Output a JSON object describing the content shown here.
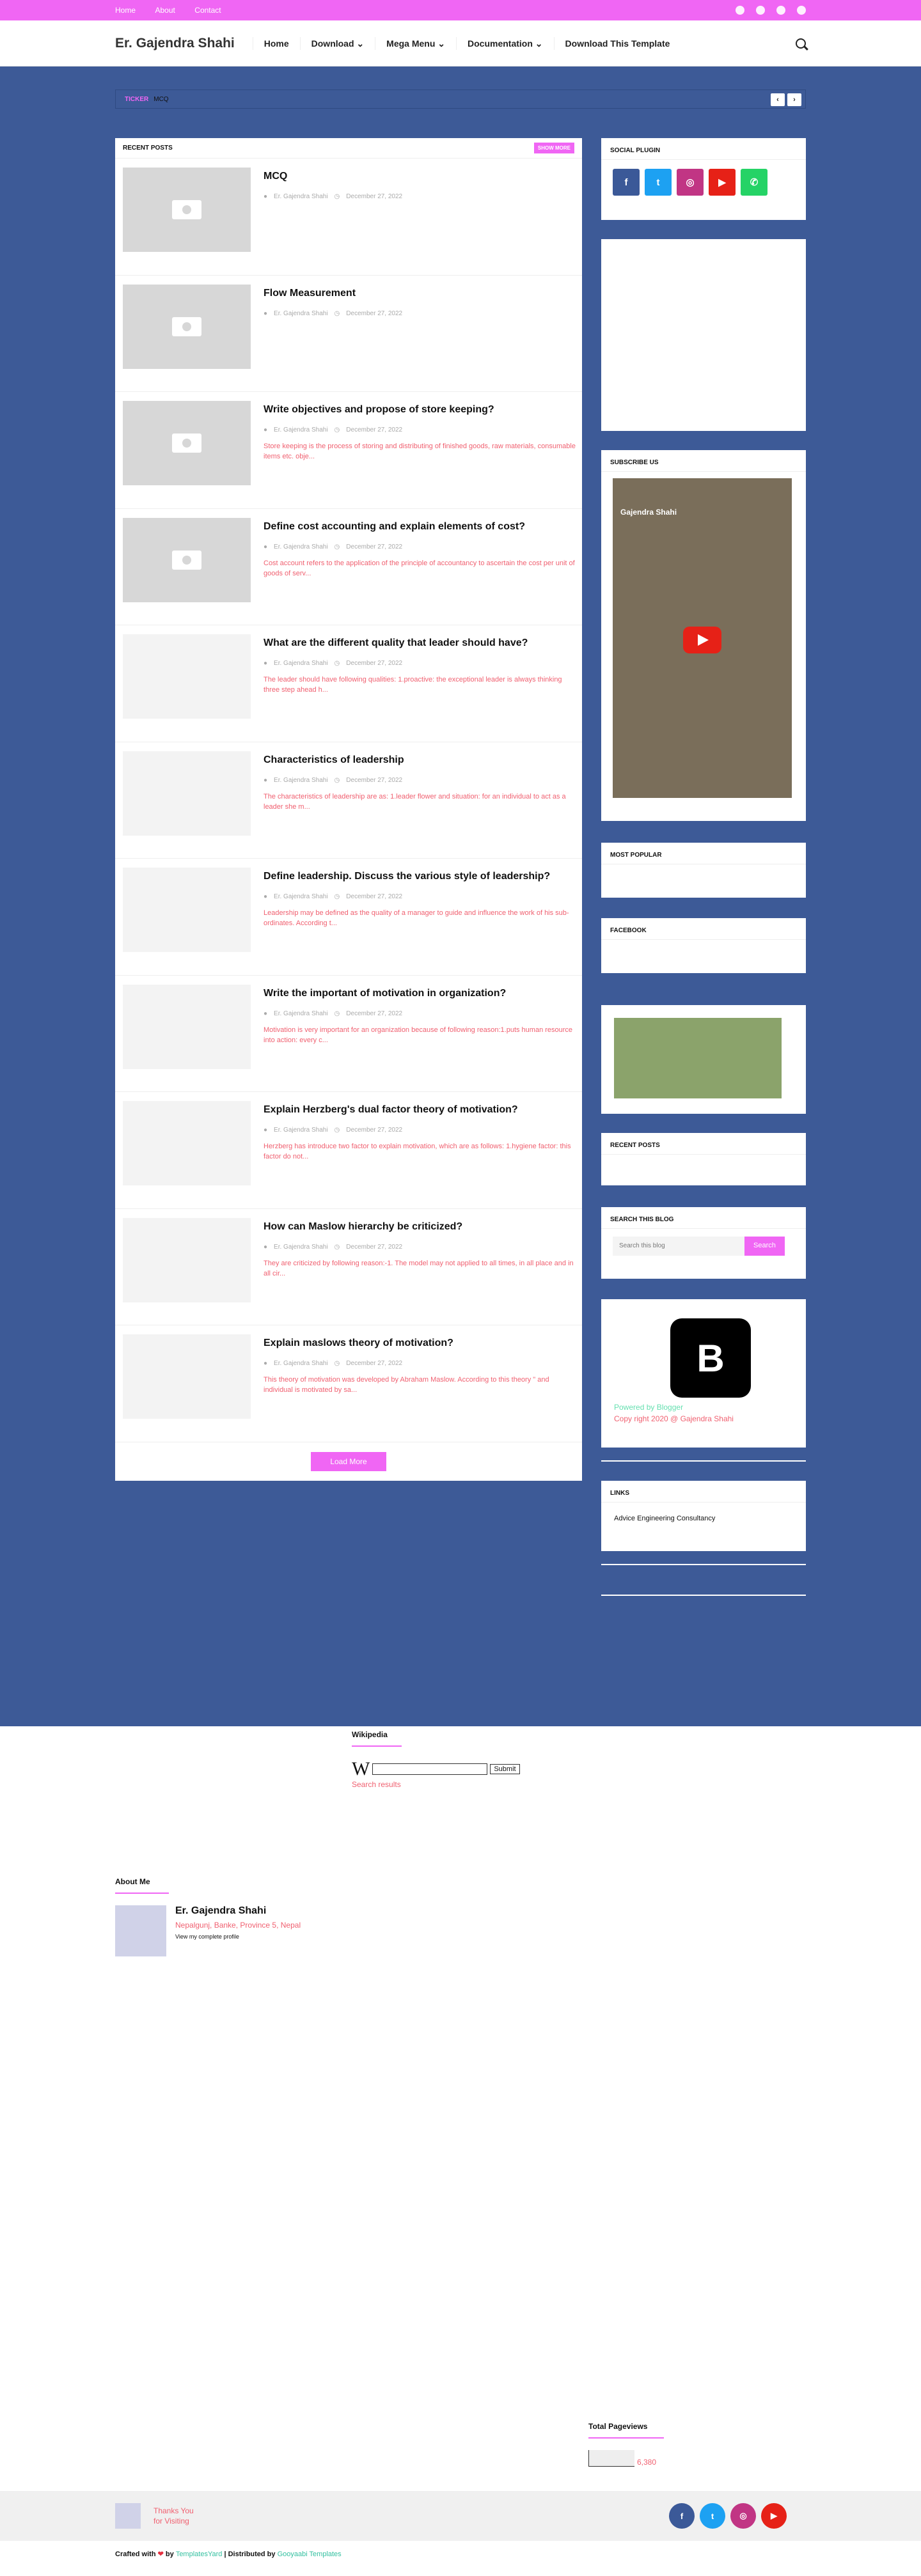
{
  "topbar": {
    "links": [
      "Home",
      "About",
      "Contact"
    ],
    "social_icons": [
      "facebook-icon",
      "twitter-icon",
      "instagram-icon",
      "pinterest-icon"
    ]
  },
  "header": {
    "brand": "Er. Gajendra Shahi",
    "nav": [
      "Home",
      "Download",
      "Mega Menu",
      "Documentation",
      "Download This Template"
    ]
  },
  "ticker": {
    "label": "TICKER",
    "text": "MCQ"
  },
  "main": {
    "title": "RECENT POSTS",
    "more": "SHOW MORE",
    "author": "Er. Gajendra Shahi",
    "date": "December 27, 2022",
    "posts": [
      {
        "title": "MCQ",
        "excerpt": ""
      },
      {
        "title": "Flow Measurement",
        "excerpt": ""
      },
      {
        "title": "Write objectives and propose of store keeping?",
        "excerpt": "Store keeping is the process of storing and distributing of finished goods, raw materials, consumable items etc. obje..."
      },
      {
        "title": "Define cost accounting and explain elements of cost?",
        "excerpt": "Cost account refers to the application of the principle of accountancy to ascertain the cost per unit of goods of serv..."
      },
      {
        "title": "What are the different quality that leader should have?",
        "excerpt": "The leader should have following qualities: 1.proactive: the exceptional leader is always thinking three step ahead h..."
      },
      {
        "title": "Characteristics of leadership",
        "excerpt": "The characteristics of leadership are as: 1.leader flower and situation: for an individual to act as a leader she m..."
      },
      {
        "title": "Define leadership. Discuss the various style of leadership?",
        "excerpt": "Leadership may be defined as the quality of a manager to guide and influence the work of his sub-ordinates. According t..."
      },
      {
        "title": "Write the important of motivation in organization?",
        "excerpt": "Motivation is very important for an organization because of following reason:1.puts human resource into action: every c..."
      },
      {
        "title": "Explain Herzberg's dual factor theory of motivation?",
        "excerpt": "Herzberg has introduce two factor to explain motivation, which are as follows: 1.hygiene factor: this factor do not..."
      },
      {
        "title": "How can Maslow hierarchy be criticized?",
        "excerpt": "They are criticized by following reason:-1.      The model may not applied to all times, in all place and in all cir..."
      },
      {
        "title": "Explain maslows theory of motivation?",
        "excerpt": "This theory of motivation was developed by Abraham Maslow. According to this theory \" and individual is motivated by sa..."
      }
    ],
    "load_more": "Load More"
  },
  "sidebar": {
    "social_title": "SOCIAL PLUGIN",
    "social": [
      {
        "icon": "facebook-icon",
        "color": "#3b5998",
        "glyph": "f"
      },
      {
        "icon": "twitter-icon",
        "color": "#1da1f2",
        "glyph": "t"
      },
      {
        "icon": "instagram-icon",
        "color": "#c13584",
        "glyph": "◎"
      },
      {
        "icon": "youtube-icon",
        "color": "#e62117",
        "glyph": "▶"
      },
      {
        "icon": "whatsapp-icon",
        "color": "#25d366",
        "glyph": "✆"
      }
    ],
    "subscribe_title": "SUBSCRIBE US",
    "video_channel": "Gajendra Shahi",
    "most_popular": "MOST POPULAR",
    "facebook": "FACEBOOK",
    "recent_posts": "RECENT POSTS",
    "search_title": "SEARCH THIS BLOG",
    "search_placeholder": "Search this blog",
    "search_button": "Search",
    "powered": "Powered by Blogger",
    "copyright": "Copy right 2020 @ Gajendra Shahi",
    "links_title": "LINKS",
    "links": [
      "Advice Engineering Consultancy"
    ]
  },
  "wiki": {
    "title": "Wikipedia",
    "submit": "Submit",
    "results": "Search results"
  },
  "about": {
    "title": "About Me",
    "name": "Er. Gajendra Shahi",
    "location": "Nepalgunj, Banke, Province 5, Nepal",
    "profile": "View my complete profile"
  },
  "pageviews": {
    "title": "Total Pageviews",
    "count": "6,380"
  },
  "footer": {
    "thanks1": "Thanks You",
    "thanks2": "for Visiting",
    "social": [
      {
        "icon": "facebook-icon",
        "color": "#3b5998",
        "glyph": "f"
      },
      {
        "icon": "twitter-icon",
        "color": "#1da1f2",
        "glyph": "t"
      },
      {
        "icon": "instagram-icon",
        "color": "#c13584",
        "glyph": "◎"
      },
      {
        "icon": "youtube-icon",
        "color": "#e62117",
        "glyph": "▶"
      }
    ]
  },
  "credit": {
    "crafted": "Crafted with",
    "by": "by",
    "templates": "TemplatesYard",
    "distributed": "| Distributed by",
    "gooyaabi": "Gooyaabi Templates"
  }
}
